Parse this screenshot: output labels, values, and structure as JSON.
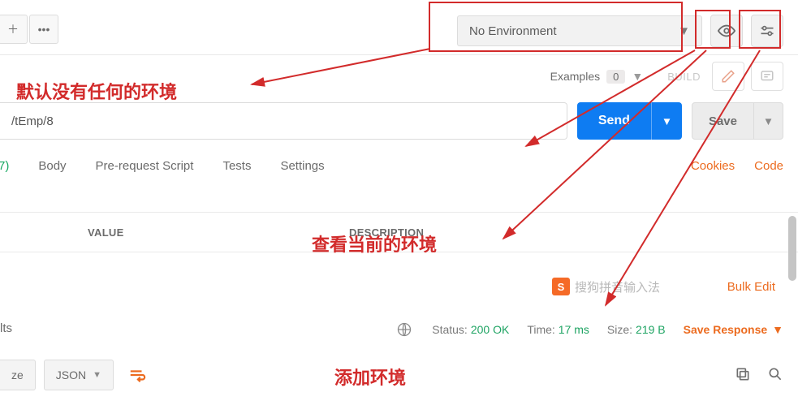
{
  "env": {
    "selected": "No Environment"
  },
  "examples": {
    "label": "Examples",
    "count": "0"
  },
  "build": "BUILD",
  "url": "/tEmp/8",
  "buttons": {
    "send": "Send",
    "save": "Save",
    "save_response": "Save Response"
  },
  "tabs": {
    "seven": "7)",
    "body": "Body",
    "prerequest": "Pre-request Script",
    "tests": "Tests",
    "settings": "Settings"
  },
  "links": {
    "cookies": "Cookies",
    "code": "Code",
    "bulk_edit": "Bulk Edit"
  },
  "table": {
    "col_value": "VALUE",
    "col_desc": "DESCRIPTION"
  },
  "lts": "lts",
  "status": {
    "status_label": "Status:",
    "status_value": "200 OK",
    "time_label": "Time:",
    "time_value": "17 ms",
    "size_label": "Size:",
    "size_value": "219 B"
  },
  "bottom": {
    "ze": "ze",
    "json": "JSON"
  },
  "ime": {
    "icon_letter": "S",
    "text": "搜狗拼音输入法"
  },
  "annotations": {
    "a1": "默认没有任何的环境",
    "a2": "查看当前的环境",
    "a3": "添加环境"
  }
}
